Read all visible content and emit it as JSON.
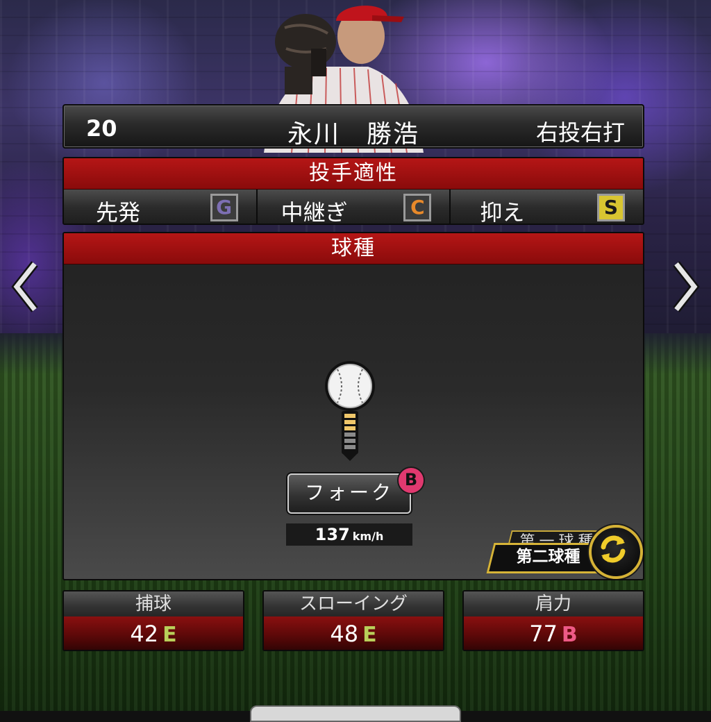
{
  "header": {
    "number": "20",
    "name": "永川　勝浩",
    "handedness": "右投右打"
  },
  "aptitude": {
    "title": "投手適性",
    "items": [
      {
        "label": "先発",
        "grade": "G",
        "color": "#7d6fb3"
      },
      {
        "label": "中継ぎ",
        "grade": "C",
        "color": "#e8892a"
      },
      {
        "label": "抑え",
        "grade": "S",
        "color": "#d8c531"
      }
    ]
  },
  "pitches": {
    "title": "球種",
    "pitch": {
      "name": "フォーク",
      "grade": "B",
      "grade_color": "#e0396f"
    },
    "speed": {
      "value": "137",
      "unit": "km/h"
    },
    "tab_back": "第一球種",
    "tab_front": "第二球種",
    "ball_direction": "down",
    "break_segments_yellow": 3,
    "break_segments_gray": 3
  },
  "stats": [
    {
      "label": "捕球",
      "value": "42",
      "grade": "E",
      "grade_color": "#b9cf5a"
    },
    {
      "label": "スローイング",
      "value": "48",
      "grade": "E",
      "grade_color": "#b9cf5a"
    },
    {
      "label": "肩力",
      "value": "77",
      "grade": "B",
      "grade_color": "#ee5a86"
    }
  ],
  "icons": {
    "left_arrow": "chevron-left-icon",
    "right_arrow": "chevron-right-icon",
    "swap": "swap-icon",
    "ball": "baseball-icon"
  }
}
